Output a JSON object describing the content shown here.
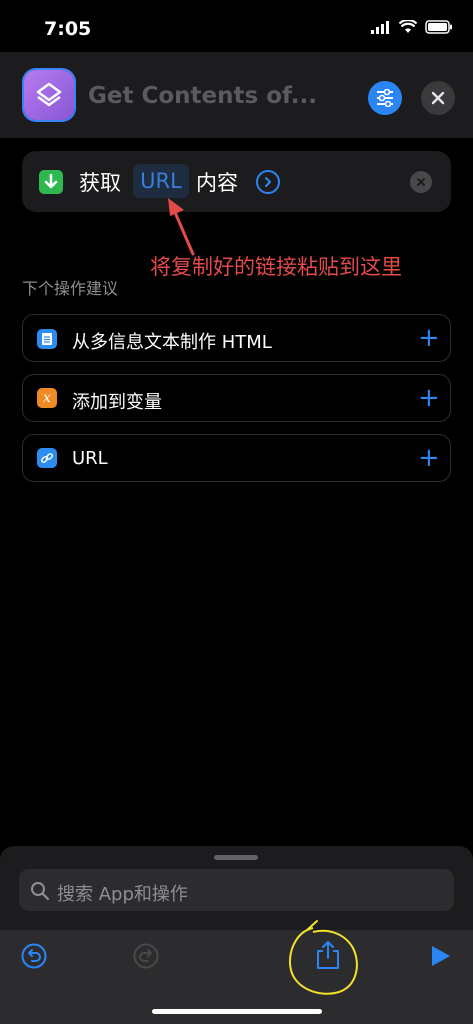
{
  "status_bar": {
    "time": "7:05"
  },
  "header": {
    "title": "Get Contents of...",
    "app_icon": "shortcuts-layers-icon",
    "filter_icon": "sliders-icon",
    "close_icon": "close-icon"
  },
  "action": {
    "verb": "获取",
    "token": "URL",
    "suffix": "内容",
    "icon": "download-arrow-icon",
    "expand_icon": "chevron-right-icon",
    "remove_icon": "close-icon"
  },
  "annotation": {
    "text": "将复制好的链接粘贴到这里",
    "color": "#e34a4a"
  },
  "suggestions": {
    "heading": "下个操作建议",
    "items": [
      {
        "label": "从多信息文本制作 HTML",
        "icon": "document-icon",
        "color": "#2d8cf0"
      },
      {
        "label": "添加到变量",
        "icon": "variable-x-icon",
        "color": "#f08a24"
      },
      {
        "label": "URL",
        "icon": "link-icon",
        "color": "#2d8cf0"
      }
    ]
  },
  "bottom_sheet": {
    "search_placeholder": "搜索 App和操作",
    "toolbar": {
      "undo": "undo-icon",
      "redo": "redo-icon",
      "share": "share-icon",
      "run": "play-icon"
    }
  },
  "colors": {
    "accent": "#2a86f5",
    "background": "#000000",
    "card": "#1c1c1e"
  }
}
